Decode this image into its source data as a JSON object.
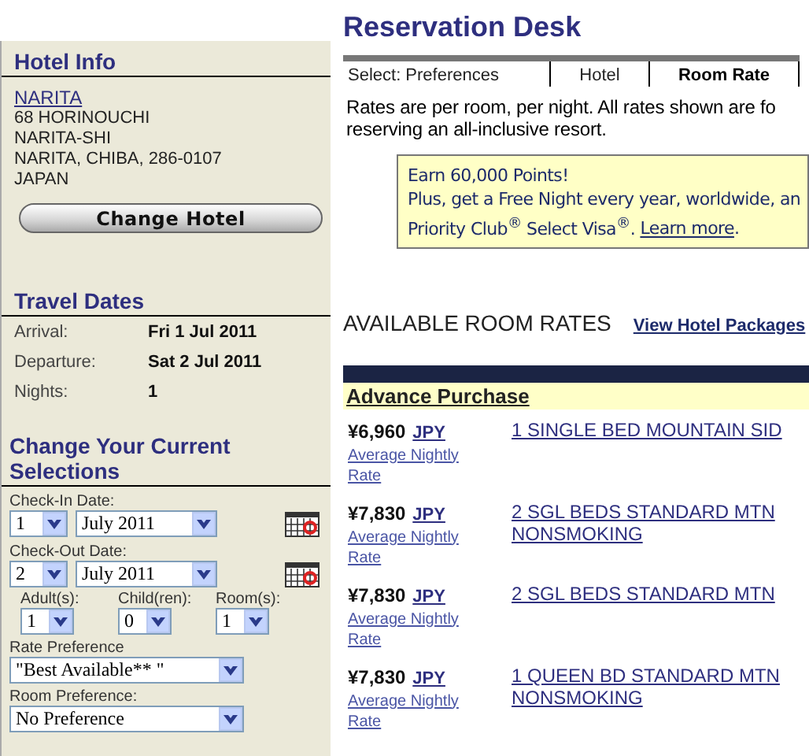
{
  "sidebar": {
    "hotel_info": {
      "title": "Hotel Info",
      "name": "NARITA",
      "address": [
        "68 HORINOUCHI",
        "NARITA-SHI",
        "NARITA, CHIBA, 286-0107",
        "JAPAN"
      ],
      "button": "Change Hotel"
    },
    "travel_dates": {
      "title": "Travel Dates",
      "rows": [
        {
          "label": "Arrival:",
          "value": "Fri 1 Jul 2011"
        },
        {
          "label": "Departure:",
          "value": "Sat 2 Jul 2011"
        },
        {
          "label": "Nights:",
          "value": "1"
        }
      ]
    },
    "selections": {
      "title": "Change Your Current Selections",
      "dates": [
        {
          "label": "Check-In Date:",
          "day": "1",
          "month": "July 2011"
        },
        {
          "label": "Check-Out Date:",
          "day": "2",
          "month": "July 2011"
        }
      ],
      "guests": [
        {
          "label": "Adult(s):",
          "value": "1"
        },
        {
          "label": "Child(ren):",
          "value": "0"
        },
        {
          "label": "Room(s):",
          "value": "1"
        }
      ],
      "preferences": [
        {
          "label": "Rate Preference",
          "value": "\"Best Available** \""
        },
        {
          "label": "Room Preference:",
          "value": "No Preference"
        }
      ]
    }
  },
  "main": {
    "title": "Reservation Desk",
    "tabs": [
      {
        "label": "Select: Preferences",
        "selected": false
      },
      {
        "label": "Hotel",
        "selected": false
      },
      {
        "label": "Room Rate",
        "selected": true
      }
    ],
    "notice": [
      "Rates are per room, per night. All rates shown are fo",
      "reserving an all-inclusive resort."
    ],
    "promo": {
      "headline": "Earn 60,000 Points!",
      "line": "Plus, get a Free Night every year, worldwide, an",
      "card": "Priority Club$^{®}$ Select Visa$^{®}$. ",
      "link": "Learn more",
      "end": "."
    },
    "rates_heading": "AVAILABLE ROOM RATES",
    "packages_link": "View Hotel Packages",
    "group": "Advance Purchase",
    "rates": [
      {
        "price": "¥6,960",
        "currency": "JPY",
        "note": [
          "Average Nightly",
          "Rate"
        ],
        "room": [
          "1 SINGLE BED MOUNTAIN SID"
        ]
      },
      {
        "price": "¥7,830",
        "currency": "JPY",
        "note": [
          "Average Nightly",
          "Rate"
        ],
        "room": [
          "2 SGL BEDS STANDARD MTN",
          "NONSMOKING"
        ]
      },
      {
        "price": "¥7,830",
        "currency": "JPY",
        "note": [
          "Average Nightly",
          "Rate"
        ],
        "room": [
          "2 SGL BEDS STANDARD MTN"
        ]
      },
      {
        "price": "¥7,830",
        "currency": "JPY",
        "note": [
          "Average Nightly",
          "Rate"
        ],
        "room": [
          "1 QUEEN BD STANDARD MTN",
          "NONSMOKING"
        ]
      }
    ]
  }
}
